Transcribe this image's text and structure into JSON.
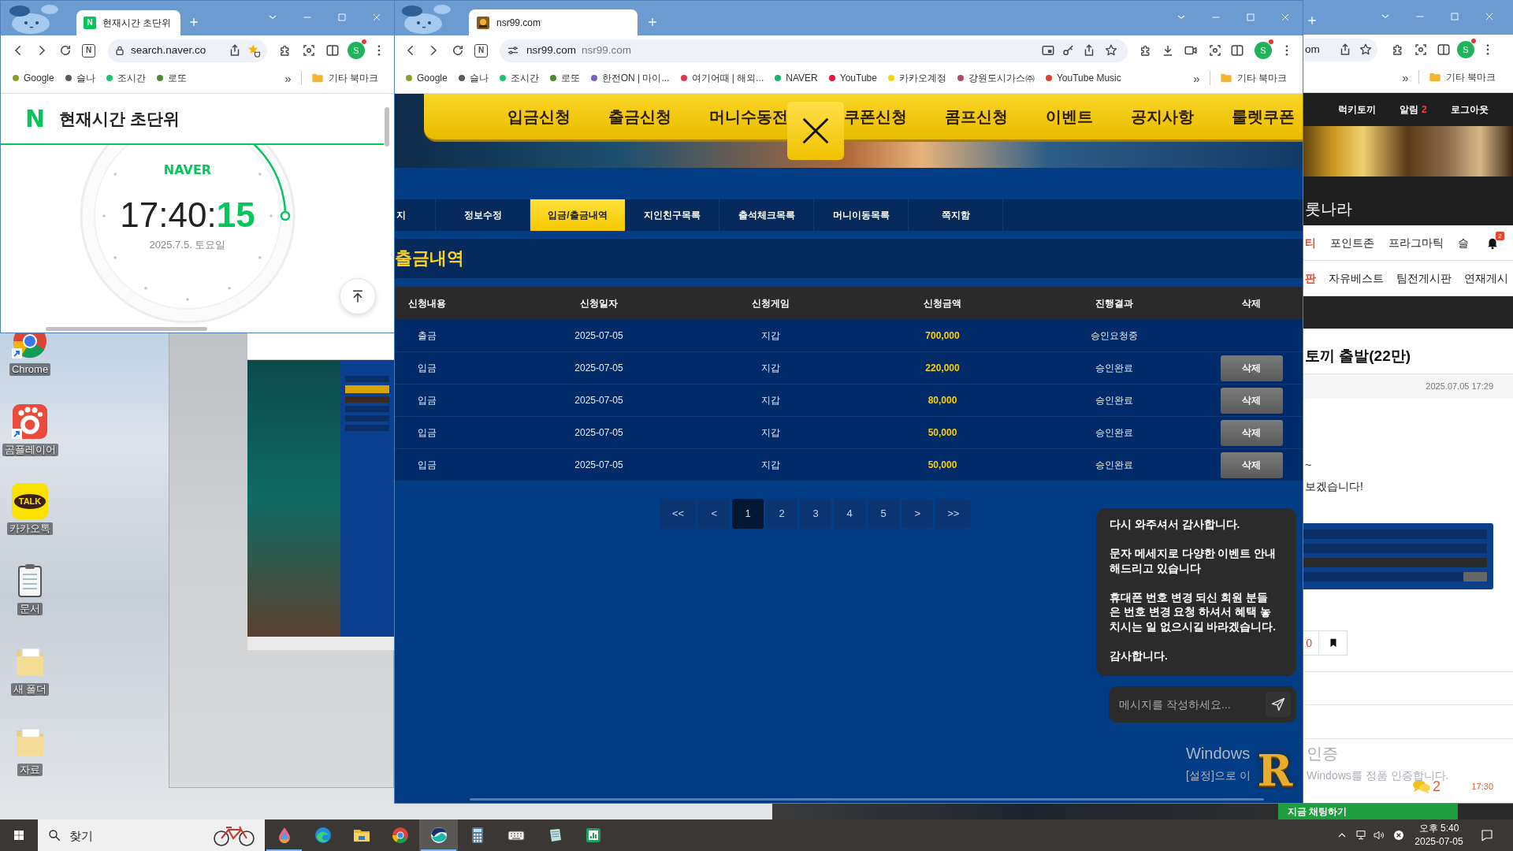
{
  "desktop": {
    "shortcuts": [
      {
        "label": "Chrome",
        "kind": "chrome"
      },
      {
        "label": "곰플레이어",
        "kind": "player"
      },
      {
        "label": "카카오톡",
        "kind": "talk",
        "logo_text": "TALK"
      },
      {
        "label": "문서",
        "kind": "notepad"
      },
      {
        "label": "새 폴더",
        "kind": "folder"
      },
      {
        "label": "자료",
        "kind": "folder"
      }
    ]
  },
  "left_window": {
    "tab": {
      "favicon_letter": "N",
      "title": "현재시간 초단위"
    },
    "toolbar": {
      "extension_letter": "N",
      "url": "search.naver.co",
      "profile_letter": "S"
    },
    "bookmarks": [
      {
        "label": "Google",
        "color": "#8aa12c"
      },
      {
        "label": "슬나",
        "color": "#5a5a5a"
      },
      {
        "label": "조시간",
        "color": "#1fc46a"
      },
      {
        "label": "로또",
        "color": "#4e8a2c"
      }
    ],
    "bookmarks_overflow": "»",
    "other_bookmarks": "기타 북마크",
    "page": {
      "logo": "N",
      "title": "현재시간 초단위",
      "brand": "NAVER",
      "time": "17:40:",
      "seconds": "15",
      "date": "2025.7.5. 토요일"
    }
  },
  "main_window": {
    "tab": {
      "title": "nsr99.com"
    },
    "toolbar": {
      "extension_letter": "N",
      "url": "nsr99.com",
      "url_hint": "nsr99.com",
      "profile_letter": "S"
    },
    "bookmarks": [
      {
        "label": "Google",
        "color": "#8aa12c"
      },
      {
        "label": "슬나",
        "color": "#5a5a5a"
      },
      {
        "label": "조시간",
        "color": "#1fc46a"
      },
      {
        "label": "로또",
        "color": "#4e8a2c"
      },
      {
        "label": "한전ON | 마이...",
        "color": "#7b5fc8"
      },
      {
        "label": "여기어때 | 해외...",
        "color": "#e9334b"
      },
      {
        "label": "NAVER",
        "color": "#18b46b"
      },
      {
        "label": "YouTube",
        "color": "#e8173a"
      },
      {
        "label": "카카오계정",
        "color": "#f3d60c"
      },
      {
        "label": "강원도시가스㈜",
        "color": "#b24a6e"
      },
      {
        "label": "YouTube Music",
        "color": "#d8432f"
      }
    ],
    "bookmarks_overflow": "»",
    "other_bookmarks": "기타 북마크",
    "page": {
      "nav": [
        {
          "kind": "link",
          "label": "입금신청"
        },
        {
          "kind": "link",
          "label": "출금신청"
        },
        {
          "kind": "link",
          "label": "머니수동전"
        },
        {
          "kind": "close"
        },
        {
          "kind": "link",
          "label": "쿠폰신청"
        },
        {
          "kind": "link",
          "label": "콤프신청"
        },
        {
          "kind": "link",
          "label": "이벤트"
        },
        {
          "kind": "link",
          "label": "공지사항"
        },
        {
          "kind": "link",
          "label": "룰렛쿠폰"
        }
      ],
      "tabs": [
        {
          "label": "지",
          "selected": false
        },
        {
          "label": "정보수정",
          "selected": false
        },
        {
          "label": "입금/출금내역",
          "selected": true
        },
        {
          "label": "지인친구목록",
          "selected": false
        },
        {
          "label": "출석체크목록",
          "selected": false
        },
        {
          "label": "머니이동목록",
          "selected": false
        },
        {
          "label": "쪽지함",
          "selected": false
        }
      ],
      "section_title": "출금내역",
      "table": {
        "columns": [
          "신청내용",
          "신청일자",
          "신청게임",
          "신청금액",
          "진행결과",
          "삭제"
        ],
        "rows": [
          {
            "type": "출금",
            "date": "2025-07-05",
            "game": "지갑",
            "amount": "700,000",
            "status": "승인요청중"
          },
          {
            "type": "입금",
            "date": "2025-07-05",
            "game": "지갑",
            "amount": "220,000",
            "status": "승인완료",
            "delete": "삭제"
          },
          {
            "type": "입금",
            "date": "2025-07-05",
            "game": "지갑",
            "amount": "80,000",
            "status": "승인완료",
            "delete": "삭제"
          },
          {
            "type": "입금",
            "date": "2025-07-05",
            "game": "지갑",
            "amount": "50,000",
            "status": "승인완료",
            "delete": "삭제"
          },
          {
            "type": "입금",
            "date": "2025-07-05",
            "game": "지갑",
            "amount": "50,000",
            "status": "승인완료",
            "delete": "삭제"
          }
        ]
      },
      "pagination": [
        {
          "label": "<<",
          "selected": false
        },
        {
          "label": "<",
          "selected": false
        },
        {
          "label": "1",
          "selected": true
        },
        {
          "label": "2",
          "selected": false
        },
        {
          "label": "3",
          "selected": false
        },
        {
          "label": "4",
          "selected": false
        },
        {
          "label": "5",
          "selected": false
        },
        {
          "label": ">",
          "selected": false
        },
        {
          "label": ">>",
          "selected": false
        }
      ],
      "chat": {
        "messages": [
          "다시 와주셔서 감사합니다.",
          "문자 메세지로 다양한 이벤트 안내 해드리고 있습니다",
          "휴대폰 번호 변경 되신 회원 분들은 번호 변경 요청 하셔서 혜택 놓치시는 일 없으시길 바라겠습니다.",
          "감사합니다."
        ],
        "input": {
          "placeholder": "메시지를 작성하세요..."
        }
      },
      "floating_logo": "R"
    }
  },
  "right_window": {
    "toolbar": {
      "url": "om",
      "profile_letter": "S"
    },
    "bookmarks_overflow": "»",
    "other_bookmarks": "기타 북마크",
    "page": {
      "header_links": [
        {
          "label": "럭키토끼"
        },
        {
          "label": "알림",
          "count": "2"
        },
        {
          "label": "로그아웃"
        }
      ],
      "site_title": "롯나라",
      "menu_rows": [
        {
          "items": [
            {
              "label": "티",
              "highlighted": true
            },
            {
              "label": "포인트존",
              "highlighted": false
            },
            {
              "label": "프라그마틱",
              "highlighted": false
            },
            {
              "label": "슬",
              "highlighted": false
            }
          ],
          "bell_badge": "2"
        },
        {
          "items": [
            {
              "label": "판",
              "highlighted": true
            },
            {
              "label": "자유베스트",
              "highlighted": false
            },
            {
              "label": "팀전게시판",
              "highlighted": false
            },
            {
              "label": "연재게시",
              "highlighted": false
            }
          ]
        }
      ],
      "post": {
        "title": "토끼 출발(22만)",
        "date": "2025.07.05 17:29",
        "lines": [
          "~",
          "보겠습니다!"
        ],
        "like_count": "0"
      },
      "comment": {
        "count": "2",
        "time": "17:30"
      }
    }
  },
  "background_window": {
    "chat_bar": "지금 채팅하기"
  },
  "activation_notice": {
    "line_1": [
      "Windows",
      "인증"
    ],
    "line_2": [
      "[설정]으로 이",
      "Windows를 정품 인증합니다."
    ]
  },
  "taskbar": {
    "search": {
      "placeholder": "찾기"
    },
    "apps": [
      {
        "kind": "drop",
        "active": false,
        "open": true
      },
      {
        "kind": "edge",
        "active": false,
        "open": false
      },
      {
        "kind": "folder",
        "active": false,
        "open": false
      },
      {
        "kind": "chrome",
        "active": false,
        "open": false
      },
      {
        "kind": "app",
        "active": true,
        "open": true
      },
      {
        "kind": "calculator",
        "active": false,
        "open": false
      },
      {
        "kind": "keyboard",
        "active": false,
        "open": false
      },
      {
        "kind": "notepad",
        "active": false,
        "open": false
      },
      {
        "kind": "chart",
        "active": false,
        "open": false
      }
    ],
    "clock": {
      "time": "오후 5:40",
      "date": "2025-07-05"
    }
  }
}
